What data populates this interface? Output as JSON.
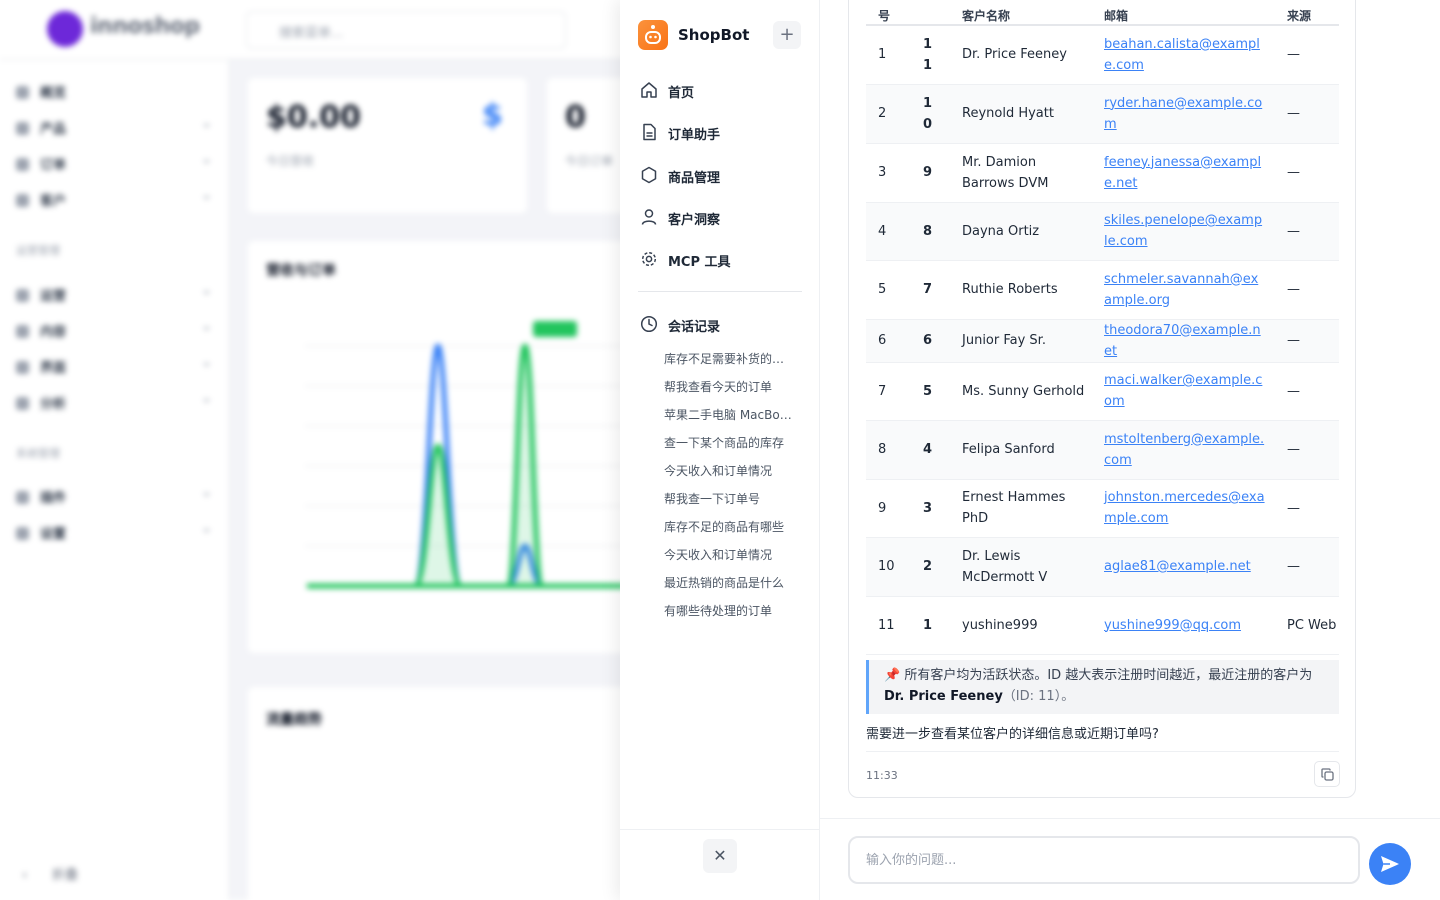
{
  "background": {
    "brand": "innoshop",
    "search_placeholder": "搜索菜单...",
    "nav": [
      "概览",
      "产品",
      "订单",
      "客户",
      "运营",
      "内容",
      "界面",
      "分析",
      "插件",
      "设置"
    ],
    "groups": [
      "运营管理",
      "系统管理"
    ],
    "collapse_label": "折叠",
    "stat1_value": "$0.00",
    "stat1_label": "今日营收",
    "stat2_value": "0",
    "stat2_label": "今日订单",
    "chart1_title": "营收与订单",
    "chart2_title": "流量趋势",
    "dollar_symbol": "$"
  },
  "sidebar": {
    "app_name": "ShopBot",
    "new_chat": "+",
    "menu": [
      {
        "label": "首页",
        "icon": "home-icon"
      },
      {
        "label": "订单助手",
        "icon": "document-icon"
      },
      {
        "label": "商品管理",
        "icon": "hexagon-icon"
      },
      {
        "label": "客户洞察",
        "icon": "user-icon"
      },
      {
        "label": "MCP 工具",
        "icon": "gear-icon"
      }
    ],
    "history_title": "会话记录",
    "history": [
      "库存不足需要补货的商品",
      "帮我查看今天的订单",
      "苹果二手电脑 MacBook",
      "查一下某个商品的库存",
      "今天收入和订单情况",
      "帮我查一下订单号",
      "库存不足的商品有哪些",
      "今天收入和订单情况",
      "最近热销的商品是什么",
      "有哪些待处理的订单"
    ],
    "close": "✕"
  },
  "table": {
    "headers": [
      "号",
      "",
      "客户名称",
      "邮箱",
      "来源"
    ],
    "rows": [
      {
        "no": "1",
        "id": "11",
        "name": "Dr. Price Feeney",
        "email": "beahan.calista@example.com",
        "source": "—"
      },
      {
        "no": "2",
        "id": "10",
        "name": "Reynold Hyatt",
        "email": "ryder.hane@example.com",
        "source": "—"
      },
      {
        "no": "3",
        "id": "9",
        "name": "Mr. Damion Barrows DVM",
        "email": "feeney.janessa@example.net",
        "source": "—"
      },
      {
        "no": "4",
        "id": "8",
        "name": "Dayna Ortiz",
        "email": "skiles.penelope@example.com",
        "source": "—"
      },
      {
        "no": "5",
        "id": "7",
        "name": "Ruthie Roberts",
        "email": "schmeler.savannah@example.org",
        "source": "—"
      },
      {
        "no": "6",
        "id": "6",
        "name": "Junior Fay Sr.",
        "email": "theodora70@example.net",
        "source": "—"
      },
      {
        "no": "7",
        "id": "5",
        "name": "Ms. Sunny Gerhold",
        "email": "maci.walker@example.com",
        "source": "—"
      },
      {
        "no": "8",
        "id": "4",
        "name": "Felipa Sanford",
        "email": "mstoltenberg@example.com",
        "source": "—"
      },
      {
        "no": "9",
        "id": "3",
        "name": "Ernest Hammes PhD",
        "email": "johnston.mercedes@example.com",
        "source": "—"
      },
      {
        "no": "10",
        "id": "2",
        "name": "Dr. Lewis McDermott V",
        "email": "aglae81@example.net",
        "source": "—"
      },
      {
        "no": "11",
        "id": "1",
        "name": "yushine999",
        "email": "yushine999@qq.com",
        "source": "PC Web"
      }
    ]
  },
  "message": {
    "note_icon": "📌",
    "note_text": "所有客户均为活跃状态。ID 越大表示注册时间越近，最近注册的客户为",
    "note_name": "Dr. Price Feeney",
    "note_id": "（ID: 11）。",
    "followup": "需要进一步查看某位客户的详细信息或近期订单吗?",
    "time": "11:33"
  },
  "input": {
    "placeholder": "输入你的问题..."
  },
  "colors": {
    "accent": "#3b82f6",
    "brand_orange": "#f97316"
  }
}
